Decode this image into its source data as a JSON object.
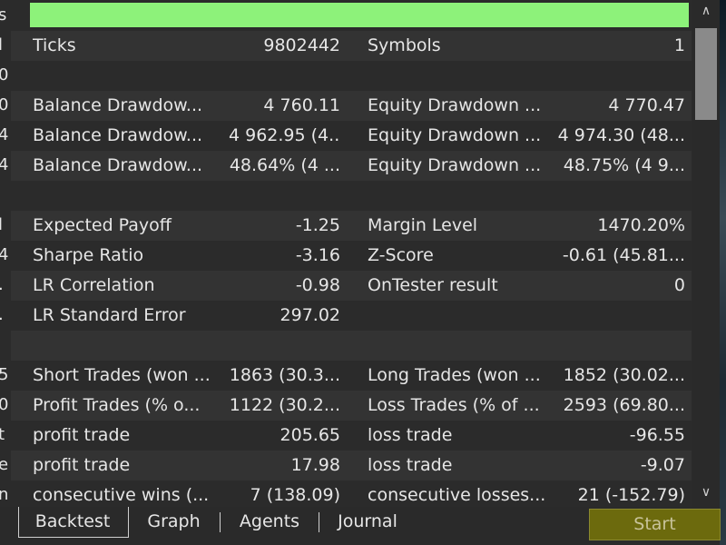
{
  "progress": {
    "value": 1.0,
    "color": "#8df27a"
  },
  "left_edge_chars": [
    "s",
    "l",
    "0",
    "0",
    "4",
    "4",
    "",
    "l",
    "4",
    ".",
    ".",
    "",
    "5",
    "0",
    "t",
    "e",
    "n"
  ],
  "rows": [
    {
      "c1": "Ticks",
      "c2": "9802442",
      "c3": "Symbols",
      "c4": "1"
    },
    {
      "c1": "",
      "c2": "",
      "c3": "",
      "c4": ""
    },
    {
      "c1": "Balance Drawdow...",
      "c2": "4 760.11",
      "c3": "Equity Drawdown ...",
      "c4": "4 770.47"
    },
    {
      "c1": "Balance Drawdow...",
      "c2": "4 962.95 (4...",
      "c3": "Equity Drawdown ...",
      "c4": "4 974.30 (48..."
    },
    {
      "c1": "Balance Drawdow...",
      "c2": "48.64% (4 ...",
      "c3": "Equity Drawdown ...",
      "c4": "48.75% (4 9..."
    },
    {
      "c1": "",
      "c2": "",
      "c3": "",
      "c4": ""
    },
    {
      "c1": "Expected Payoff",
      "c2": "-1.25",
      "c3": "Margin Level",
      "c4": "1470.20%"
    },
    {
      "c1": "Sharpe Ratio",
      "c2": "-3.16",
      "c3": "Z-Score",
      "c4": "-0.61 (45.81..."
    },
    {
      "c1": "LR Correlation",
      "c2": "-0.98",
      "c3": "OnTester result",
      "c4": "0"
    },
    {
      "c1": "LR Standard Error",
      "c2": "297.02",
      "c3": "",
      "c4": ""
    },
    {
      "c1": "",
      "c2": "",
      "c3": "",
      "c4": ""
    },
    {
      "c1": "Short Trades (won ...",
      "c2": "1863 (30.3...",
      "c3": "Long Trades (won ...",
      "c4": "1852 (30.02..."
    },
    {
      "c1": "Profit Trades (% o...",
      "c2": "1122 (30.2...",
      "c3": "Loss Trades (% of ...",
      "c4": "2593 (69.80..."
    },
    {
      "c1": "profit trade",
      "c2": "205.65",
      "c3": "loss trade",
      "c4": "-96.55"
    },
    {
      "c1": "profit trade",
      "c2": "17.98",
      "c3": "loss trade",
      "c4": "-9.07"
    },
    {
      "c1": "consecutive wins (...",
      "c2": "7 (138.09)",
      "c3": "consecutive losses...",
      "c4": "21 (-152.79)"
    }
  ],
  "tabs": [
    "Backtest",
    "Graph",
    "Agents",
    "Journal"
  ],
  "start_button": "Start",
  "scroll_up_glyph": "∧",
  "scroll_down_glyph": "∨",
  "colors": {
    "background": "#2b2b2b",
    "alt_row": "#333333",
    "text": "#e6e6e6",
    "start_bg": "#6c6a0d",
    "start_text": "#c8c39a"
  }
}
